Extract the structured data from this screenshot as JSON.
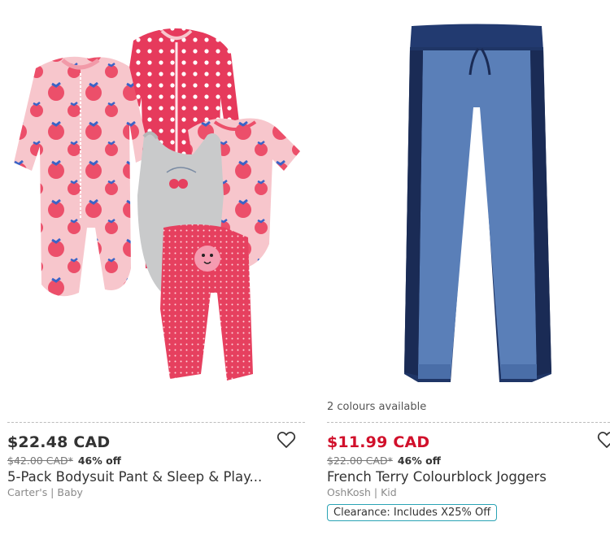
{
  "products": [
    {
      "price": "$22.48 CAD",
      "was_price": "$42.00 CAD*",
      "discount": "46% off",
      "title": "5-Pack Bodysuit Pant & Sleep & Play...",
      "brand": "Carter's | Baby",
      "image_alt": "5-pack baby set: pink raspberry sleep & play, pink polka-dot sleeper, grey tank bodysuit, raspberry bodysuit, pink dot pant",
      "sale_color": "#333333"
    },
    {
      "colours_available": "2 colours available",
      "price": "$11.99 CAD",
      "was_price": "$22.00 CAD*",
      "discount": "46% off",
      "title": "French Terry Colourblock Joggers",
      "brand": "OshKosh | Kid",
      "promo": "Clearance: Includes X25% Off",
      "image_alt": "Blue and navy colourblock jogger pants",
      "sale_color": "#d1102b"
    }
  ],
  "icons": {
    "wishlist": "heart-outline-icon"
  }
}
